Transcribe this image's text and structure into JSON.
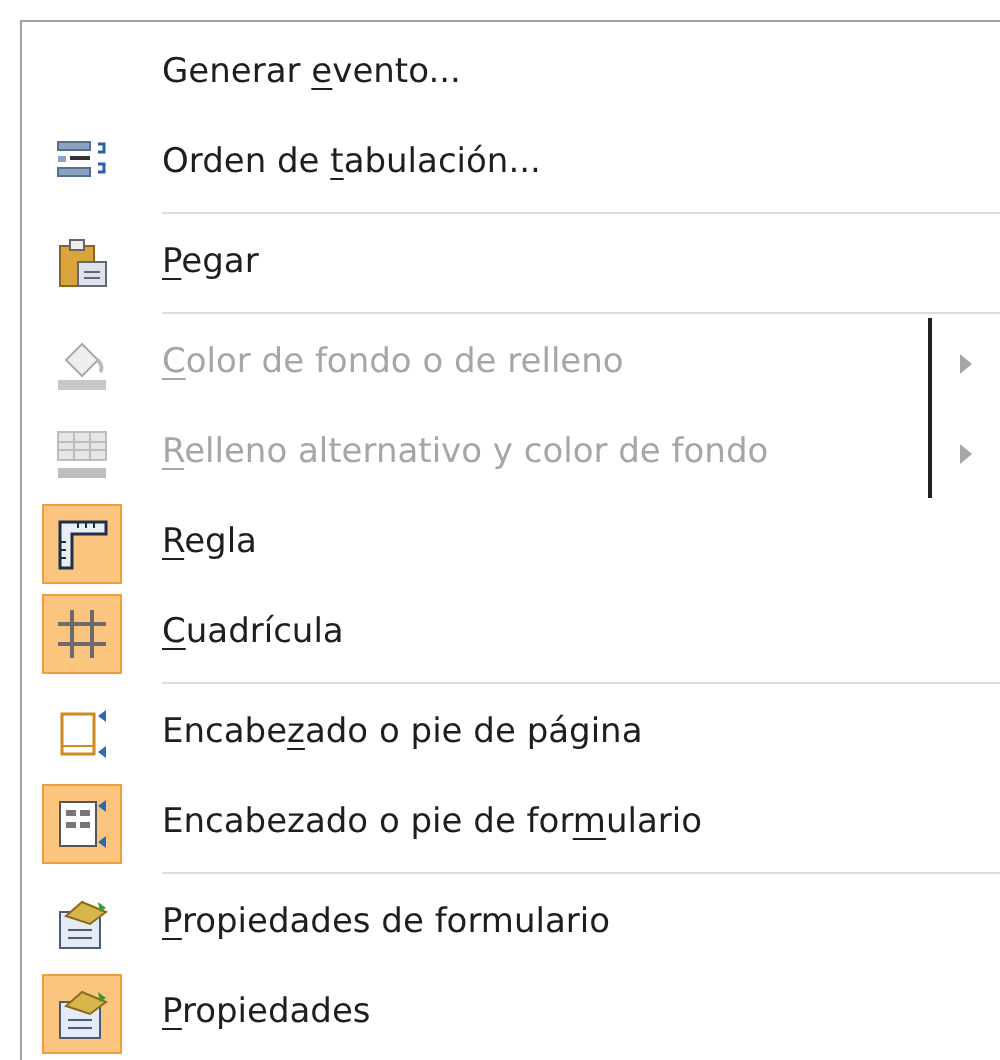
{
  "menu": {
    "items": [
      {
        "kind": "command",
        "label_before": "Generar ",
        "access_key": "e",
        "label_after": "vento...",
        "checked": false,
        "disabled": false,
        "separator_after": false
      },
      {
        "kind": "command",
        "label_before": "Orden de ",
        "access_key": "t",
        "label_after": "abulación...",
        "checked": false,
        "disabled": false,
        "separator_after": true
      },
      {
        "kind": "command",
        "access_key": "P",
        "label_after": "egar",
        "checked": false,
        "disabled": false,
        "separator_after": true
      },
      {
        "kind": "submenu",
        "access_key": "C",
        "label_after": "olor de fondo o de relleno",
        "checked": false,
        "disabled": true,
        "separator_after": false
      },
      {
        "kind": "submenu",
        "access_key": "R",
        "label_after": "elleno alternativo y color de fondo",
        "checked": false,
        "disabled": true,
        "separator_after": false
      },
      {
        "kind": "command",
        "access_key": "R",
        "label_after": "egla",
        "checked": true,
        "disabled": false,
        "separator_after": false
      },
      {
        "kind": "command",
        "access_key": "C",
        "label_after": "uadrícula",
        "checked": true,
        "disabled": false,
        "separator_after": true
      },
      {
        "kind": "command",
        "label_before": "Encabe",
        "access_key": "z",
        "label_after": "ado o pie de página",
        "checked": false,
        "disabled": false,
        "separator_after": false
      },
      {
        "kind": "command",
        "label_before": "Encabezado o pie de for",
        "access_key": "m",
        "label_after": "ulario",
        "checked": true,
        "disabled": false,
        "separator_after": true
      },
      {
        "kind": "command",
        "access_key": "P",
        "label_after": "ropiedades de formulario",
        "checked": false,
        "disabled": false,
        "separator_after": false
      },
      {
        "kind": "command",
        "access_key": "P",
        "label_after": "ropiedades",
        "checked": true,
        "disabled": false,
        "separator_after": false
      }
    ]
  }
}
